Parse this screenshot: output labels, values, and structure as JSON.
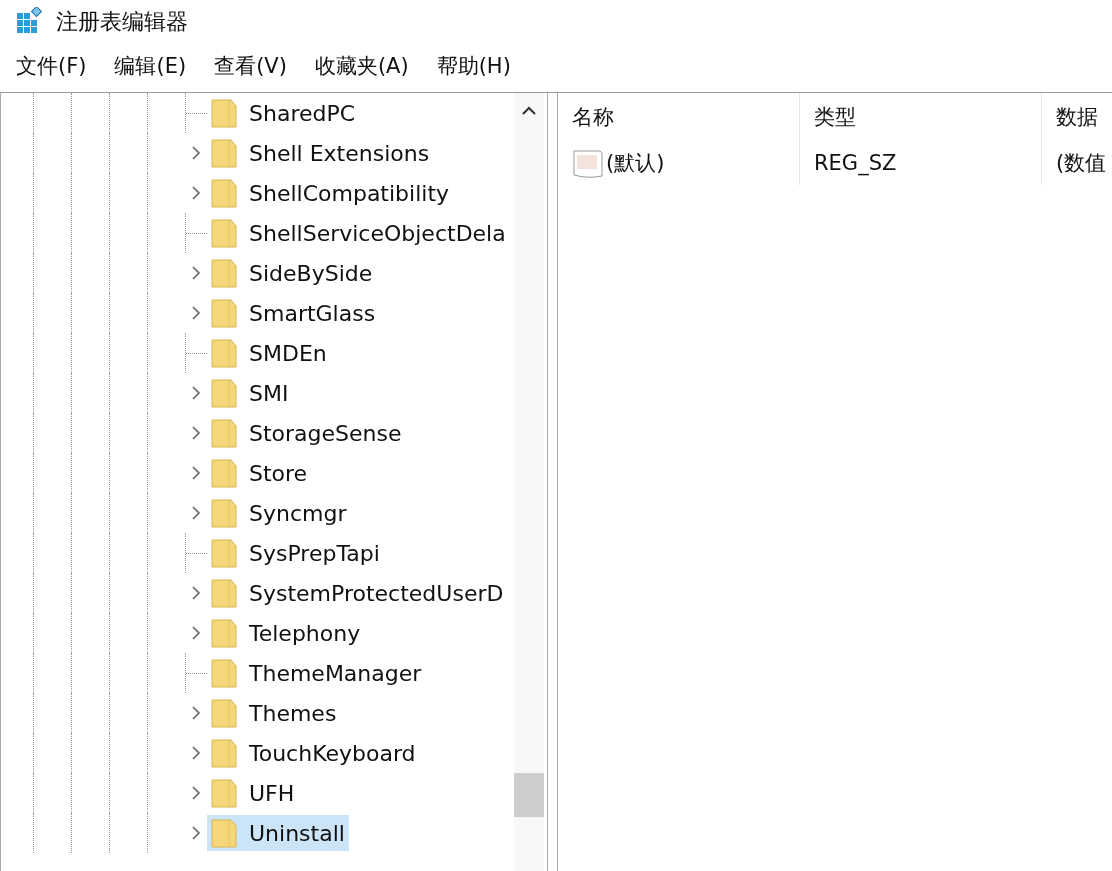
{
  "window": {
    "title": "注册表编辑器"
  },
  "menu": [
    "文件(F)",
    "编辑(E)",
    "查看(V)",
    "收藏夹(A)",
    "帮助(H)"
  ],
  "tree": {
    "items": [
      {
        "label": "SharedPC",
        "expandable": false,
        "selected": false
      },
      {
        "label": "Shell Extensions",
        "expandable": true,
        "selected": false
      },
      {
        "label": "ShellCompatibility",
        "expandable": true,
        "selected": false
      },
      {
        "label": "ShellServiceObjectDela",
        "expandable": false,
        "selected": false
      },
      {
        "label": "SideBySide",
        "expandable": true,
        "selected": false
      },
      {
        "label": "SmartGlass",
        "expandable": true,
        "selected": false
      },
      {
        "label": "SMDEn",
        "expandable": false,
        "selected": false
      },
      {
        "label": "SMI",
        "expandable": true,
        "selected": false
      },
      {
        "label": "StorageSense",
        "expandable": true,
        "selected": false
      },
      {
        "label": "Store",
        "expandable": true,
        "selected": false
      },
      {
        "label": "Syncmgr",
        "expandable": true,
        "selected": false
      },
      {
        "label": "SysPrepTapi",
        "expandable": false,
        "selected": false
      },
      {
        "label": "SystemProtectedUserD",
        "expandable": true,
        "selected": false
      },
      {
        "label": "Telephony",
        "expandable": true,
        "selected": false
      },
      {
        "label": "ThemeManager",
        "expandable": false,
        "selected": false
      },
      {
        "label": "Themes",
        "expandable": true,
        "selected": false
      },
      {
        "label": "TouchKeyboard",
        "expandable": true,
        "selected": false
      },
      {
        "label": "UFH",
        "expandable": true,
        "selected": false
      },
      {
        "label": "Uninstall",
        "expandable": true,
        "selected": true
      }
    ]
  },
  "values": {
    "columns": [
      "名称",
      "类型",
      "数据"
    ],
    "rows": [
      {
        "name": "(默认)",
        "type": "REG_SZ",
        "data": "(数值"
      }
    ]
  }
}
